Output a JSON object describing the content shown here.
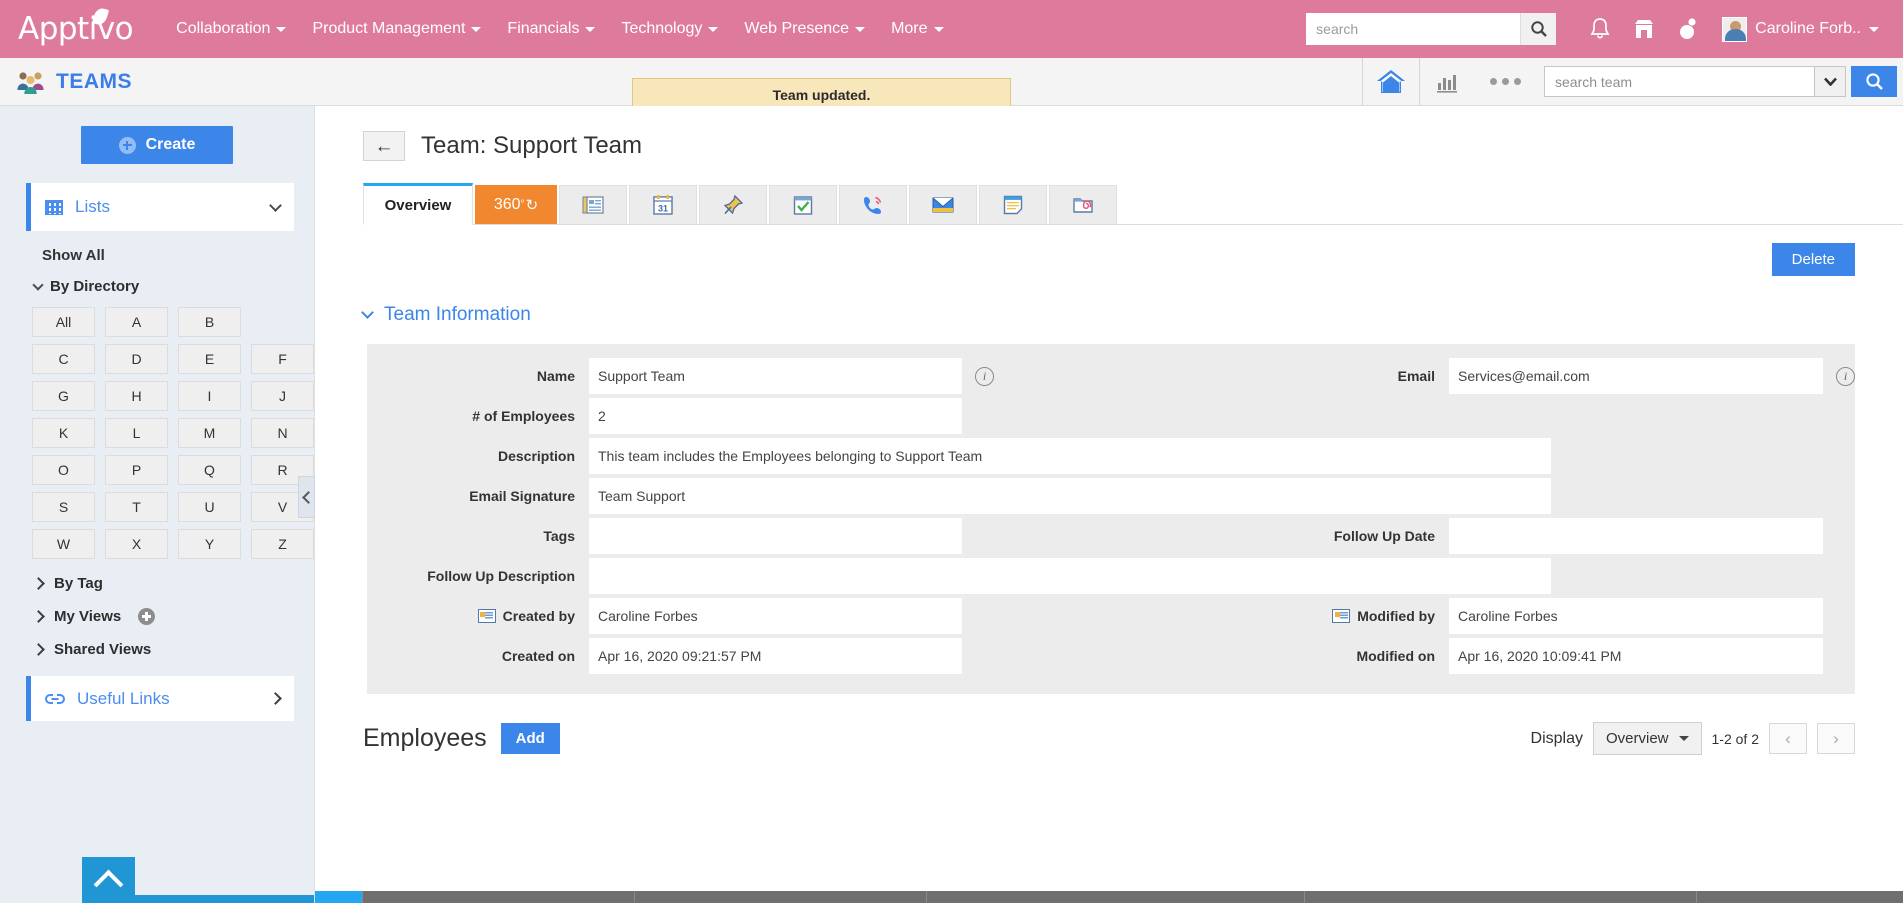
{
  "topnav": {
    "logo": "Apptivo",
    "items": [
      {
        "label": "Collaboration",
        "caret": true
      },
      {
        "label": "Product Management",
        "caret": true
      },
      {
        "label": "Financials",
        "caret": true
      },
      {
        "label": "Technology",
        "caret": true
      },
      {
        "label": "Web Presence",
        "caret": true
      },
      {
        "label": "More",
        "caret": true
      }
    ],
    "search_placeholder": "search",
    "search_value": "",
    "icons": [
      "bell-icon",
      "store-icon",
      "pin-drop-icon"
    ],
    "user_name": "Caroline Forb.."
  },
  "appbar": {
    "app_name": "TEAMS",
    "toast_message": "Team updated.",
    "team_search_placeholder": "search team",
    "team_search_value": ""
  },
  "sidebar": {
    "create_label": "Create",
    "lists_label": "Lists",
    "show_all_label": "Show All",
    "by_directory_label": "By Directory",
    "alphabet": [
      "All",
      "A",
      "B",
      "C",
      "D",
      "E",
      "F",
      "G",
      "H",
      "I",
      "J",
      "K",
      "L",
      "M",
      "N",
      "O",
      "P",
      "Q",
      "R",
      "S",
      "T",
      "U",
      "V",
      "W",
      "X",
      "Y",
      "Z"
    ],
    "by_tag_label": "By Tag",
    "my_views_label": "My Views",
    "shared_views_label": "Shared Views",
    "useful_links_label": "Useful Links"
  },
  "main": {
    "page_title": "Team: Support Team",
    "back_label": "←",
    "delete_label": "Delete",
    "tabs": [
      {
        "label": "Overview",
        "type": "text",
        "state": "active"
      },
      {
        "label": "360",
        "type": "degree",
        "state": "orange"
      },
      {
        "label": "",
        "type": "icon",
        "icon": "news-icon"
      },
      {
        "label": "",
        "type": "icon",
        "icon": "calendar-icon"
      },
      {
        "label": "",
        "type": "icon",
        "icon": "pin-icon"
      },
      {
        "label": "",
        "type": "icon",
        "icon": "task-icon"
      },
      {
        "label": "",
        "type": "icon",
        "icon": "phone-icon"
      },
      {
        "label": "",
        "type": "icon",
        "icon": "email-icon"
      },
      {
        "label": "",
        "type": "icon",
        "icon": "notes-icon"
      },
      {
        "label": "",
        "type": "icon",
        "icon": "attachment-icon"
      }
    ],
    "section_title": "Team Information",
    "fields": {
      "name_label": "Name",
      "name_value": "Support Team",
      "email_label": "Email",
      "email_value": "Services@email.com",
      "employees_label": "# of Employees",
      "employees_value": "2",
      "description_label": "Description",
      "description_value": "This team includes the Employees belonging to Support Team",
      "signature_label": "Email Signature",
      "signature_value": "Team Support",
      "tags_label": "Tags",
      "tags_value": "",
      "followup_date_label": "Follow Up Date",
      "followup_date_value": "",
      "followup_desc_label": "Follow Up Description",
      "followup_desc_value": "",
      "created_by_label": "Created by",
      "created_by_value": "Caroline Forbes",
      "modified_by_label": "Modified by",
      "modified_by_value": "Caroline Forbes",
      "created_on_label": "Created on",
      "created_on_value": "Apr 16, 2020 09:21:57 PM",
      "modified_on_label": "Modified on",
      "modified_on_value": "Apr 16, 2020 10:09:41 PM"
    },
    "employees": {
      "title": "Employees",
      "add_label": "Add",
      "display_label": "Display",
      "display_value": "Overview",
      "count_label": "1-2 of 2"
    }
  },
  "colors": {
    "brand_pink": "#de7b9c",
    "accent_blue": "#3b86e8",
    "tab_orange": "#f1882f",
    "toast_bg": "#f8e7ba",
    "sidebar_bg": "#e9eef4"
  }
}
